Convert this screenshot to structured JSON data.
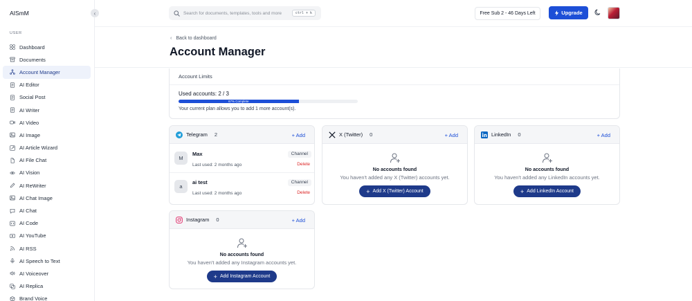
{
  "sidebar": {
    "brand": "AISmM",
    "collapse_icon": "‹",
    "section_label": "USER",
    "items": [
      {
        "label": "Dashboard",
        "icon": "grid"
      },
      {
        "label": "Documents",
        "icon": "archive"
      },
      {
        "label": "Account Manager",
        "icon": "share",
        "active": true
      },
      {
        "label": "AI Editor",
        "icon": "doc"
      },
      {
        "label": "Social Post",
        "icon": "doc"
      },
      {
        "label": "AI Writer",
        "icon": "doc"
      },
      {
        "label": "AI Video",
        "icon": "video"
      },
      {
        "label": "AI Image",
        "icon": "image"
      },
      {
        "label": "AI Article Wizard",
        "icon": "wand"
      },
      {
        "label": "AI File Chat",
        "icon": "file"
      },
      {
        "label": "AI Vision",
        "icon": "eye"
      },
      {
        "label": "AI ReWriter",
        "icon": "pen"
      },
      {
        "label": "AI Chat Image",
        "icon": "image"
      },
      {
        "label": "AI Chat",
        "icon": "chat"
      },
      {
        "label": "AI Code",
        "icon": "code"
      },
      {
        "label": "AI YouTube",
        "icon": "play"
      },
      {
        "label": "AI RSS",
        "icon": "rss"
      },
      {
        "label": "AI Speech to Text",
        "icon": "mic"
      },
      {
        "label": "AI Voiceover",
        "icon": "speaker"
      },
      {
        "label": "AI Replica",
        "icon": "copy"
      },
      {
        "label": "Brand Voice",
        "icon": "cube"
      }
    ]
  },
  "header": {
    "search_placeholder": "Search for documents, templates, tools and more",
    "shortcut": "ctrl + k",
    "plan": "Free Sub 2 - 46 Days Left",
    "upgrade_label": "Upgrade"
  },
  "page": {
    "back_label": "Back to dashboard",
    "title": "Account Manager"
  },
  "limits": {
    "title": "Account Limits",
    "used_label": "Used accounts: 2 / 3",
    "progress_fraction": 0.67,
    "progress_label": "67% Complete",
    "note": "Your current plan allows you to add 1 more account(s)."
  },
  "platforms": {
    "telegram": {
      "name": "Telegram",
      "count": "2",
      "add_label": "+ Add",
      "accounts": [
        {
          "initial": "M",
          "name": "Max",
          "badge": "Channel",
          "time": "Last used: 2 months ago",
          "delete": "Delete"
        },
        {
          "initial": "a",
          "name": "ai test",
          "badge": "Channel",
          "time": "Last used: 2 months ago",
          "delete": "Delete"
        }
      ]
    },
    "twitter": {
      "name": "X (Twitter)",
      "count": "0",
      "add_label": "+ Add",
      "empty_title": "No accounts found",
      "empty_sub": "You haven't added any X (Twitter) accounts yet.",
      "button": "Add X (Twitter) Account"
    },
    "linkedin": {
      "name": "LinkedIn",
      "count": "0",
      "add_label": "+ Add",
      "empty_title": "No accounts found",
      "empty_sub": "You haven't added any LinkedIn accounts yet.",
      "button": "Add LinkedIn Account"
    },
    "instagram": {
      "name": "Instagram",
      "count": "0",
      "add_label": "+ Add",
      "empty_title": "No accounts found",
      "empty_sub": "You haven't added any Instagram accounts yet.",
      "button": "Add Instagram Account"
    }
  },
  "colors": {
    "primary": "#1d4fd7",
    "dark_button": "#1e3a8a",
    "danger": "#dc2626",
    "telegram": "#229ed9",
    "instagram": "#e1306c",
    "linkedin": "#0a66c2"
  }
}
